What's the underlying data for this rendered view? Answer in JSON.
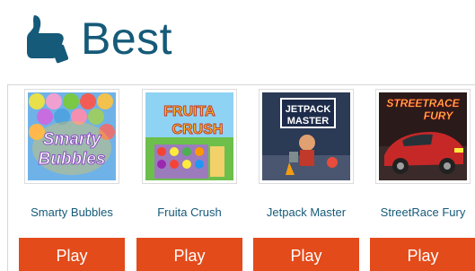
{
  "header": {
    "icon": "thumbs-up-icon",
    "title": "Best"
  },
  "games": [
    {
      "name": "Smarty Bubbles",
      "thumb_text": [
        "Smarty",
        "Bubbles"
      ],
      "play_label": "Play"
    },
    {
      "name": "Fruita Crush",
      "thumb_text": [
        "FRUITA",
        "CRUSH"
      ],
      "play_label": "Play"
    },
    {
      "name": "Jetpack Master",
      "thumb_text": [
        "JETPACK",
        "MASTER"
      ],
      "play_label": "Play"
    },
    {
      "name": "StreetRace Fury",
      "thumb_text": [
        "STREETRACE",
        "FURY"
      ],
      "play_label": "Play"
    }
  ],
  "colors": {
    "title": "#155a79",
    "play_button": "#e34b1a",
    "game_name": "#155a79"
  }
}
